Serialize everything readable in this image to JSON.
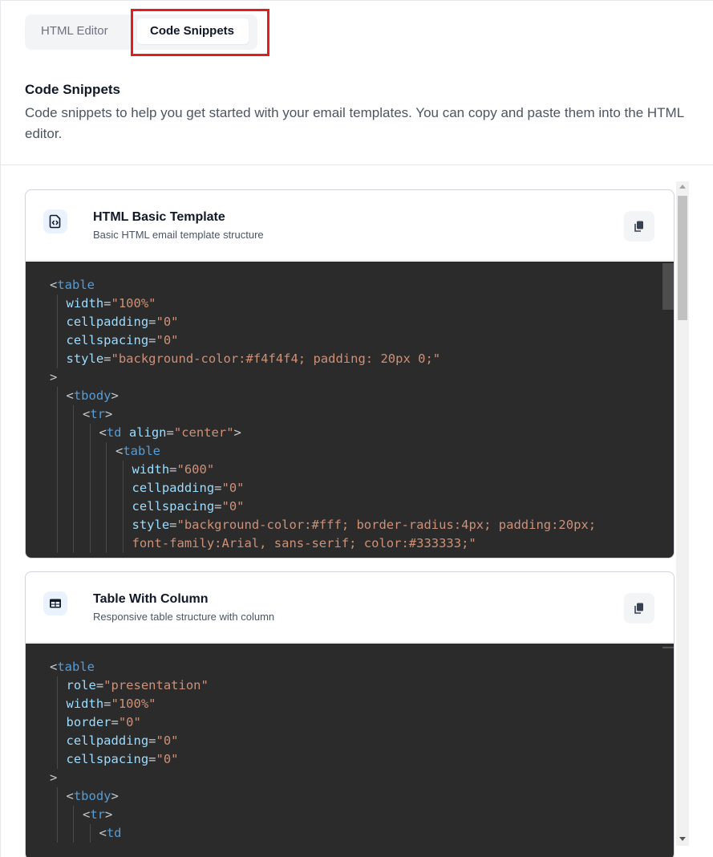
{
  "tabs": {
    "html_editor": "HTML Editor",
    "code_snippets": "Code Snippets",
    "active": "Code Snippets"
  },
  "section": {
    "title": "Code Snippets",
    "description": "Code snippets to help you get started with your email templates. You can copy and paste them into the HTML editor."
  },
  "snippets": [
    {
      "icon": "html-file-icon",
      "title": "HTML Basic Template",
      "subtitle": "Basic HTML email template structure",
      "copy_icon": "copy-icon",
      "code_lines": [
        [
          {
            "t": "<",
            "c": "punct"
          },
          {
            "t": "table",
            "c": "tag"
          }
        ],
        [
          {
            "t": "width",
            "c": "attr"
          },
          {
            "t": "=",
            "c": "punct"
          },
          {
            "t": "\"100%\"",
            "c": "str"
          }
        ],
        [
          {
            "t": "cellpadding",
            "c": "attr"
          },
          {
            "t": "=",
            "c": "punct"
          },
          {
            "t": "\"0\"",
            "c": "str"
          }
        ],
        [
          {
            "t": "cellspacing",
            "c": "attr"
          },
          {
            "t": "=",
            "c": "punct"
          },
          {
            "t": "\"0\"",
            "c": "str"
          }
        ],
        [
          {
            "t": "style",
            "c": "attr"
          },
          {
            "t": "=",
            "c": "punct"
          },
          {
            "t": "\"background-color:#f4f4f4; padding: 20px 0;\"",
            "c": "str"
          }
        ],
        [
          {
            "t": ">",
            "c": "punct"
          }
        ],
        [
          {
            "t": "<",
            "c": "punct"
          },
          {
            "t": "tbody",
            "c": "tag"
          },
          {
            "t": ">",
            "c": "punct"
          }
        ],
        [
          {
            "t": "<",
            "c": "punct"
          },
          {
            "t": "tr",
            "c": "tag"
          },
          {
            "t": ">",
            "c": "punct"
          }
        ],
        [
          {
            "t": "<",
            "c": "punct"
          },
          {
            "t": "td",
            "c": "tag"
          },
          {
            "t": " ",
            "c": "punct"
          },
          {
            "t": "align",
            "c": "attr"
          },
          {
            "t": "=",
            "c": "punct"
          },
          {
            "t": "\"center\"",
            "c": "str"
          },
          {
            "t": ">",
            "c": "punct"
          }
        ],
        [
          {
            "t": "<",
            "c": "punct"
          },
          {
            "t": "table",
            "c": "tag"
          }
        ],
        [
          {
            "t": "width",
            "c": "attr"
          },
          {
            "t": "=",
            "c": "punct"
          },
          {
            "t": "\"600\"",
            "c": "str"
          }
        ],
        [
          {
            "t": "cellpadding",
            "c": "attr"
          },
          {
            "t": "=",
            "c": "punct"
          },
          {
            "t": "\"0\"",
            "c": "str"
          }
        ],
        [
          {
            "t": "cellspacing",
            "c": "attr"
          },
          {
            "t": "=",
            "c": "punct"
          },
          {
            "t": "\"0\"",
            "c": "str"
          }
        ],
        [
          {
            "t": "style",
            "c": "attr"
          },
          {
            "t": "=",
            "c": "punct"
          },
          {
            "t": "\"background-color:#fff; border-radius:4px; padding:20px;",
            "c": "str"
          }
        ],
        [
          {
            "t": "font-family:Arial, sans-serif; color:#333333;\"",
            "c": "str"
          }
        ]
      ],
      "code_indent": [
        0,
        1,
        1,
        1,
        1,
        0,
        1,
        2,
        3,
        4,
        5,
        5,
        5,
        5,
        5
      ]
    },
    {
      "icon": "table-icon",
      "title": "Table With Column",
      "subtitle": "Responsive table structure with column",
      "copy_icon": "copy-icon",
      "code_lines": [
        [
          {
            "t": "<",
            "c": "punct"
          },
          {
            "t": "table",
            "c": "tag"
          }
        ],
        [
          {
            "t": "role",
            "c": "attr"
          },
          {
            "t": "=",
            "c": "punct"
          },
          {
            "t": "\"presentation\"",
            "c": "str"
          }
        ],
        [
          {
            "t": "width",
            "c": "attr"
          },
          {
            "t": "=",
            "c": "punct"
          },
          {
            "t": "\"100%\"",
            "c": "str"
          }
        ],
        [
          {
            "t": "border",
            "c": "attr"
          },
          {
            "t": "=",
            "c": "punct"
          },
          {
            "t": "\"0\"",
            "c": "str"
          }
        ],
        [
          {
            "t": "cellpadding",
            "c": "attr"
          },
          {
            "t": "=",
            "c": "punct"
          },
          {
            "t": "\"0\"",
            "c": "str"
          }
        ],
        [
          {
            "t": "cellspacing",
            "c": "attr"
          },
          {
            "t": "=",
            "c": "punct"
          },
          {
            "t": "\"0\"",
            "c": "str"
          }
        ],
        [
          {
            "t": ">",
            "c": "punct"
          }
        ],
        [
          {
            "t": "<",
            "c": "punct"
          },
          {
            "t": "tbody",
            "c": "tag"
          },
          {
            "t": ">",
            "c": "punct"
          }
        ],
        [
          {
            "t": "<",
            "c": "punct"
          },
          {
            "t": "tr",
            "c": "tag"
          },
          {
            "t": ">",
            "c": "punct"
          }
        ],
        [
          {
            "t": "<",
            "c": "punct"
          },
          {
            "t": "td",
            "c": "tag"
          }
        ]
      ],
      "code_indent": [
        0,
        1,
        1,
        1,
        1,
        1,
        0,
        1,
        2,
        3
      ]
    }
  ]
}
